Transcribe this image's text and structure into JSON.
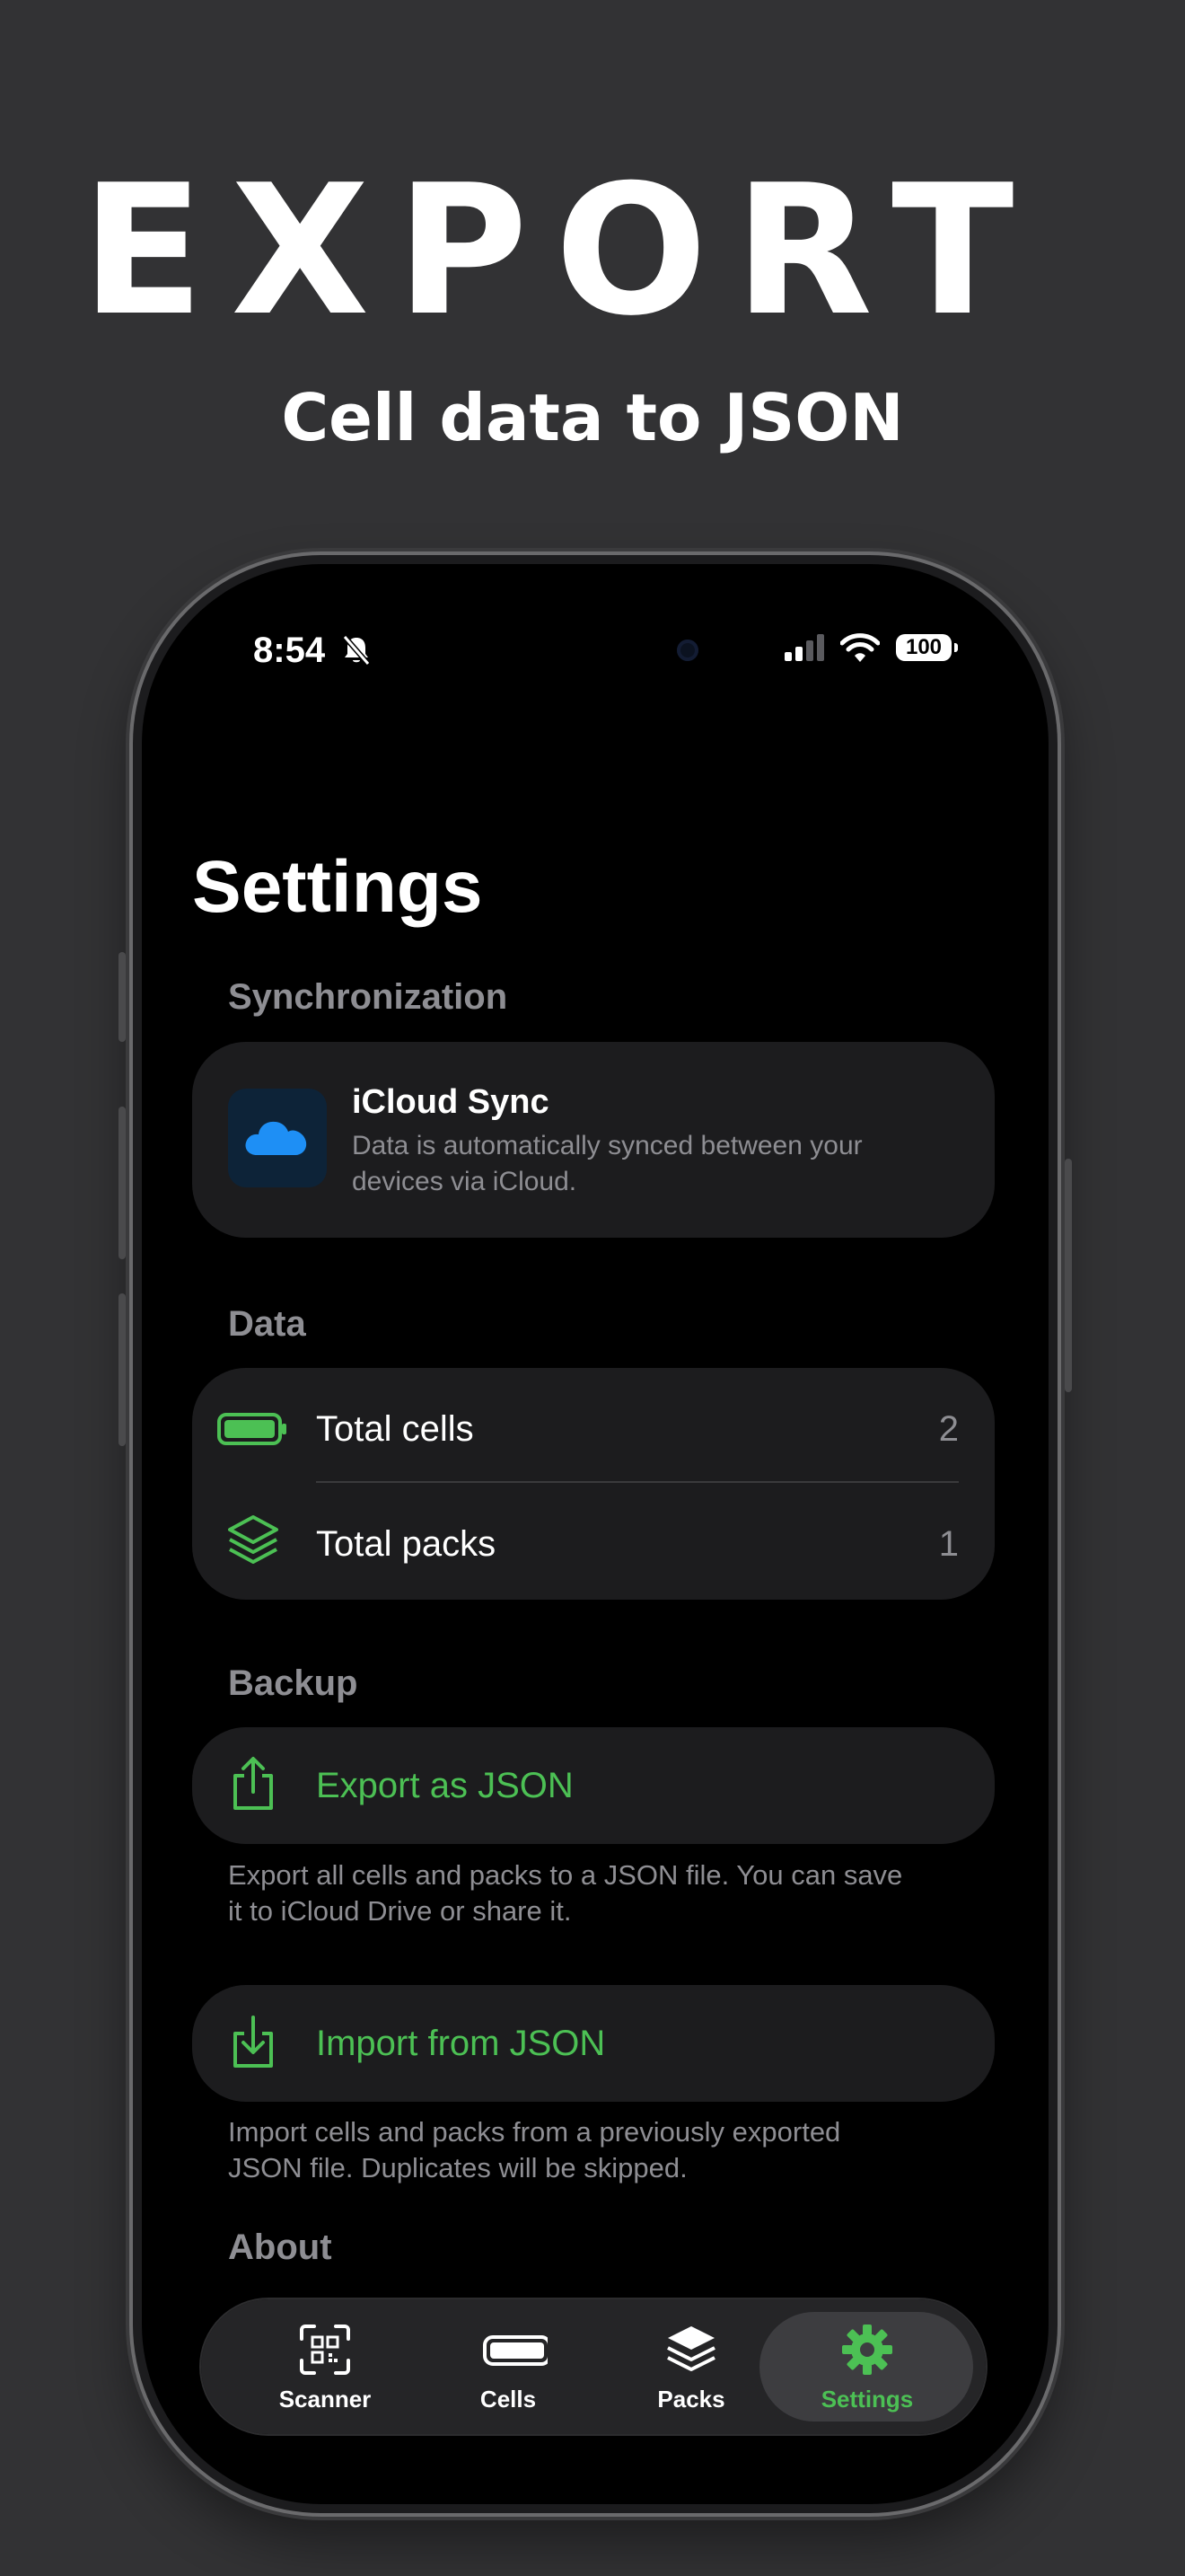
{
  "promo": {
    "headline": "EXPORT",
    "subheadline": "Cell data to JSON"
  },
  "status_bar": {
    "time": "8:54",
    "battery": "100",
    "icons": [
      "bell-slash-icon",
      "cellular-signal-icon",
      "wifi-icon",
      "battery-icon"
    ]
  },
  "page": {
    "title": "Settings"
  },
  "sync": {
    "section_title": "Synchronization",
    "title": "iCloud Sync",
    "description_line1": "Data is automatically synced between your",
    "description_line2": "devices via iCloud."
  },
  "data_section": {
    "section_title": "Data",
    "rows": [
      {
        "label": "Total cells",
        "value": "2",
        "icon": "battery-icon"
      },
      {
        "label": "Total packs",
        "value": "1",
        "icon": "stack-icon"
      }
    ]
  },
  "backup": {
    "section_title": "Backup",
    "export_label": "Export as JSON",
    "export_note_line1": "Export all cells and packs to a JSON file. You can save",
    "export_note_line2": "it to iCloud Drive or share it.",
    "import_label": "Import from JSON",
    "import_note_line1": "Import cells and packs from a previously exported",
    "import_note_line2": "JSON file. Duplicates will be skipped."
  },
  "about": {
    "section_title": "About"
  },
  "tabbar": {
    "tabs": [
      {
        "label": "Scanner",
        "icon": "qr-scanner-icon",
        "active": false
      },
      {
        "label": "Cells",
        "icon": "battery-icon",
        "active": false
      },
      {
        "label": "Packs",
        "icon": "stack-icon",
        "active": false
      },
      {
        "label": "Settings",
        "icon": "gear-icon",
        "active": true
      }
    ]
  },
  "colors": {
    "background": "#323234",
    "screen": "#000000",
    "card": "#1c1c1e",
    "accent_green": "#4cc054",
    "cloud_blue": "#1e8ff5",
    "secondary_text": "#8e8e93"
  }
}
